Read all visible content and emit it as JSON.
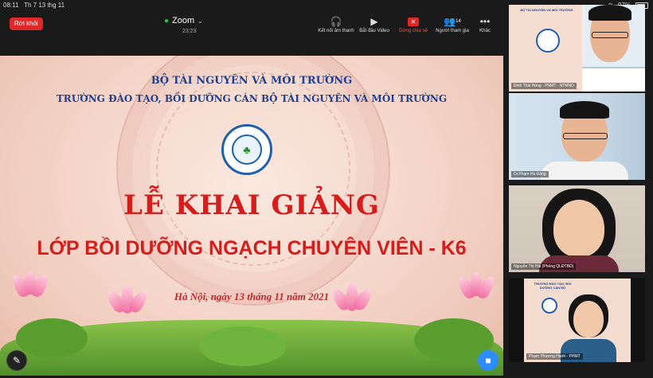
{
  "status": {
    "time": "08:11",
    "date": "Th 7 13 thg 11",
    "battery": "97%"
  },
  "header": {
    "leave_label": "Rời khỏi",
    "app_title": "Zoom",
    "duration": "23:23"
  },
  "toolbar": [
    {
      "label": "Kết nối âm thanh",
      "icon": "headphones-icon"
    },
    {
      "label": "Bắt đầu Video",
      "icon": "video-off-icon"
    },
    {
      "label": "Dừng chia sẻ",
      "icon": "stop-share-icon"
    },
    {
      "label": "Người tham gia",
      "icon": "participants-icon",
      "count": "14"
    },
    {
      "label": "Khác",
      "icon": "more-icon"
    }
  ],
  "slide": {
    "ministry": "BỘ TÀI NGUYÊN VÀ MÔI TRƯỜNG",
    "school": "TRƯỜNG ĐÀO TẠO, BỒI DƯỠNG CÁN BỘ TÀI NGUYÊN VÀ MÔI TRƯỜNG",
    "headline": "LỄ KHAI GIẢNG",
    "subline": "LỚP BỒI DƯỠNG NGẠCH CHUYÊN VIÊN - K6",
    "dateline": "Hà Nội, ngày 13 tháng 11 năm 2021"
  },
  "participants": [
    {
      "name": "Đinh Thái Hùng - PNMT - NTMNO"
    },
    {
      "name": "Dr.Phạm Hà Đăng"
    },
    {
      "name": "Nguyễn Thị Hải (Phòng QLĐTBD)"
    },
    {
      "name": "Phạm Phương Hạnh - PHMT"
    }
  ],
  "colors": {
    "accent_blue": "#2d8cff",
    "leave_red": "#e02828",
    "slide_red": "#d81b1b",
    "slide_blue": "#1f3f8f"
  }
}
